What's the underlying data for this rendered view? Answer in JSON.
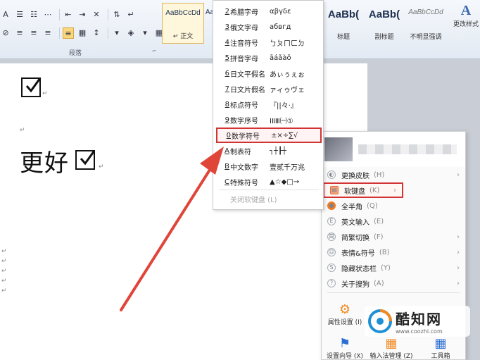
{
  "ribbon": {
    "paragraph_group_label": "段落",
    "group_launcher": "⌐",
    "row1_buttons": [
      "A",
      "☰",
      "☷",
      "⋯",
      "⇤",
      "⇥",
      "✕",
      "⇅",
      "↵"
    ],
    "row2_buttons": [
      "⊘",
      "≡",
      "≡",
      "≡",
      "≡",
      "▦",
      "↕",
      "▾",
      "◈",
      "▾",
      "▦",
      "▾"
    ],
    "styles": [
      {
        "sample": "AaBbCcDd",
        "name": "↵ 正文"
      },
      {
        "sample": "Aa",
        "name": ""
      },
      {
        "sample": "AaBb(",
        "name": "标题"
      },
      {
        "sample": "AaBb(",
        "name": "副标题"
      },
      {
        "sample": "AaBbCcDd",
        "name": "不明显强调"
      }
    ],
    "change_styles": {
      "icon": "A",
      "label": "更改样式"
    }
  },
  "document": {
    "line_text": "更好"
  },
  "soft_keyboard_menu": {
    "items": [
      {
        "key": "2",
        "label": "希腊字母",
        "sample": "αβγδε"
      },
      {
        "key": "3",
        "label": "俄文字母",
        "sample": "абвгд"
      },
      {
        "key": "4",
        "label": "注音符号",
        "sample": "ㄅㄆㄇㄈㄉ"
      },
      {
        "key": "5",
        "label": "拼音字母",
        "sample": "āáǎàō"
      },
      {
        "key": "6",
        "label": "日文平假名",
        "sample": "あぃぅぇぉ"
      },
      {
        "key": "7",
        "label": "日文片假名",
        "sample": "ァィゥヴェ"
      },
      {
        "key": "8",
        "label": "标点符号",
        "sample": "『||々·』"
      },
      {
        "key": "9",
        "label": "数字序号",
        "sample": "ⅠⅡⅢ㈠①"
      },
      {
        "key": "0",
        "label": "数学符号",
        "sample": "±×÷∑√"
      },
      {
        "key": "A",
        "label": "制表符",
        "sample": "┐┼┠┼"
      },
      {
        "key": "B",
        "label": "中文数字",
        "sample": "壹贰千万兆"
      },
      {
        "key": "C",
        "label": "特殊符号",
        "sample": "▲☆◆□→"
      }
    ],
    "close_label": "关闭软键盘 (L)"
  },
  "ime_menu": {
    "items": [
      {
        "icon": "◐",
        "label": "更换皮肤",
        "shortcut": "(H)",
        "chevron": "›"
      },
      {
        "icon": "▤",
        "label": "软键盘",
        "shortcut": "(K)",
        "chevron": "›"
      },
      {
        "icon": "●",
        "label": "全半角",
        "shortcut": "(Q)",
        "chevron": ""
      },
      {
        "icon": "E",
        "label": "英文输入",
        "shortcut": "(E)",
        "chevron": ""
      },
      {
        "icon": "简",
        "label": "简繁切换",
        "shortcut": "(F)",
        "chevron": "›"
      },
      {
        "icon": "☺",
        "label": "表情&符号",
        "shortcut": "(B)",
        "chevron": "›"
      },
      {
        "icon": "S",
        "label": "隐藏状态栏",
        "shortcut": "(Y)",
        "chevron": "›"
      },
      {
        "icon": "?",
        "label": "关于搜狗",
        "shortcut": "(A)",
        "chevron": "›"
      }
    ],
    "tiles": [
      {
        "icon": "⚙",
        "label": "属性设置 (I)"
      },
      {
        "icon": "⚑",
        "label": "设置向导 (X)"
      },
      {
        "icon": "▦",
        "label": "输入法管理 (Z)"
      },
      {
        "icon": "▦",
        "label": "工具箱"
      }
    ]
  },
  "watermark": {
    "name": "酷知网",
    "url": "www.coozhi.com"
  },
  "colors": {
    "highlight_red": "#d43333",
    "menu_bg": "#ffffff",
    "arrow": "#e0453a",
    "ribbon_bg": "#e8eef6"
  }
}
